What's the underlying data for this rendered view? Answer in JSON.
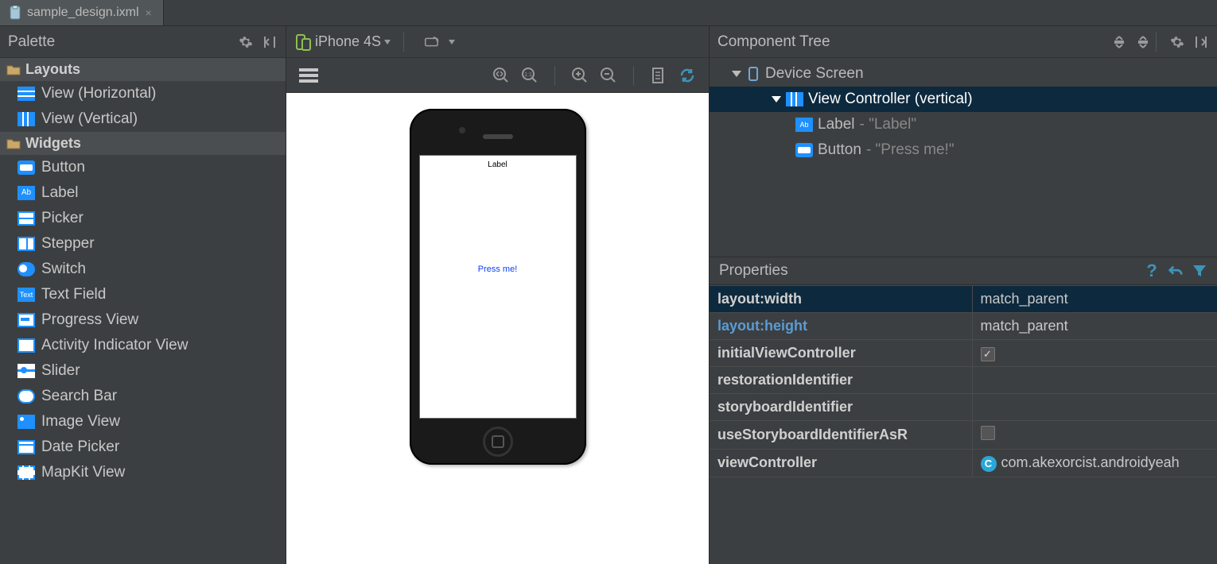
{
  "tab": {
    "filename": "sample_design.ixml"
  },
  "palette": {
    "title": "Palette",
    "groups": [
      {
        "label": "Layouts",
        "items": [
          "View (Horizontal)",
          "View (Vertical)"
        ]
      },
      {
        "label": "Widgets",
        "items": [
          "Button",
          "Label",
          "Picker",
          "Stepper",
          "Switch",
          "Text Field",
          "Progress View",
          "Activity Indicator View",
          "Slider",
          "Search Bar",
          "Image View",
          "Date Picker",
          "MapKit View"
        ]
      }
    ]
  },
  "canvas": {
    "device": "iPhone 4S",
    "preview": {
      "label_text": "Label",
      "button_text": "Press me!"
    }
  },
  "componentTree": {
    "title": "Component Tree",
    "root": "Device Screen",
    "controller": "View Controller (vertical)",
    "children": [
      {
        "type": "Label",
        "text": "Label"
      },
      {
        "type": "Button",
        "text": "Press me!"
      }
    ]
  },
  "properties": {
    "title": "Properties",
    "rows": [
      {
        "name": "layout:width",
        "value": "match_parent",
        "selected": true
      },
      {
        "name": "layout:height",
        "value": "match_parent",
        "link": true
      },
      {
        "name": "initialViewController",
        "value": "",
        "checkbox": true,
        "checked": true
      },
      {
        "name": "restorationIdentifier",
        "value": ""
      },
      {
        "name": "storyboardIdentifier",
        "value": ""
      },
      {
        "name": "useStoryboardIdentifierAsR",
        "value": "",
        "checkbox": true,
        "checked": false
      },
      {
        "name": "viewController",
        "value": "com.akexorcist.androidyeah",
        "class": true
      }
    ]
  },
  "labels": {
    "ab_text": "Ab",
    "text_icon": "Text",
    "class_badge": "C"
  }
}
